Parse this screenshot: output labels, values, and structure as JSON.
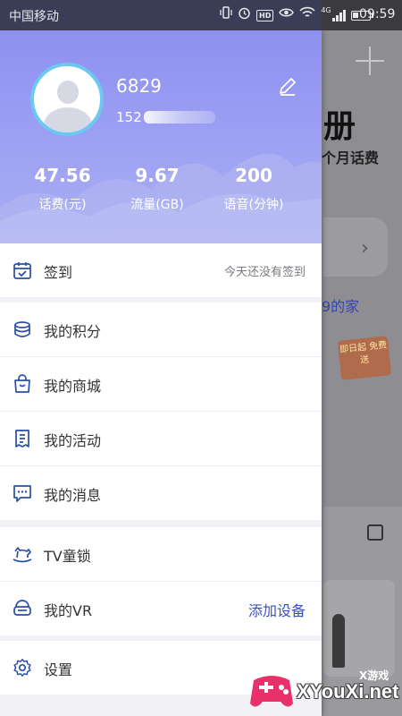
{
  "status_bar": {
    "carrier": "中国移动",
    "network": "4G",
    "hd_badge": "HD",
    "time": "09:59",
    "battery_level": 0.35,
    "icons": [
      "vibrate-icon",
      "alarm-icon",
      "hd-icon",
      "eye-icon",
      "wifi-icon",
      "signal-icon",
      "battery-icon"
    ]
  },
  "profile": {
    "name": "6829",
    "phone_prefix": "152",
    "stats": [
      {
        "value": "47.56",
        "label": "话费(元)"
      },
      {
        "value": "9.67",
        "label": "流量(GB)"
      },
      {
        "value": "200",
        "label": "语音(分钟)"
      }
    ]
  },
  "menu": {
    "signin": {
      "label": "签到",
      "status": "今天还没有签到",
      "icon": "calendar-check-icon"
    },
    "points": {
      "label": "我的积分",
      "icon": "coins-icon"
    },
    "mall": {
      "label": "我的商城",
      "icon": "shopping-bag-icon"
    },
    "activity": {
      "label": "我的活动",
      "icon": "document-icon"
    },
    "messages": {
      "label": "我的消息",
      "icon": "chat-icon"
    },
    "tv_lock": {
      "label": "TV童锁",
      "icon": "rocking-horse-icon"
    },
    "vr": {
      "label": "我的VR",
      "action": "添加设备",
      "icon": "vr-headset-icon"
    },
    "settings": {
      "label": "设置",
      "icon": "gear-icon"
    }
  },
  "background_app": {
    "banner_title": "册",
    "banner_sub": "个月话费",
    "home_text": "9的家",
    "promo_text": "即日起 免费送"
  },
  "watermark": {
    "small_text": "X游戏",
    "big_text": "XYouXi.net"
  },
  "colors": {
    "header_gradient_top": "#8e90f0",
    "header_gradient_bottom": "#a9aef2",
    "avatar_ring": "#6cc8f0",
    "icon_color": "#2a4fa8",
    "action_blue": "#3650c4"
  }
}
